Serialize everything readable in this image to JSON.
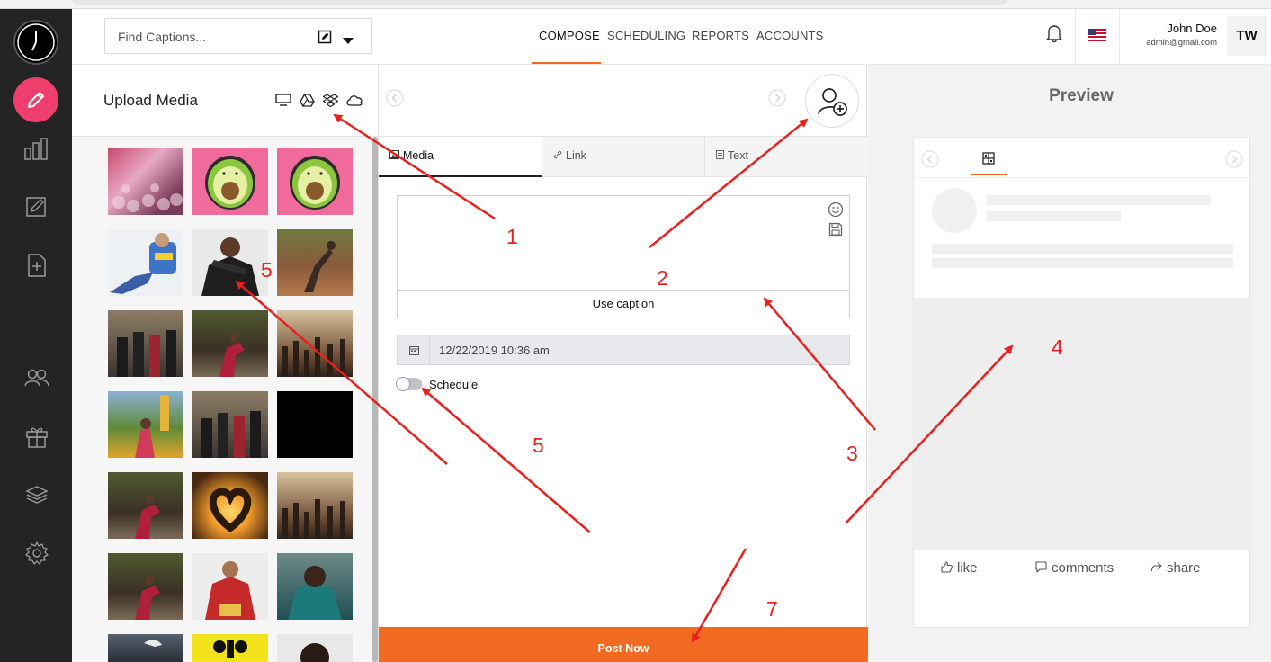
{
  "header": {
    "search_placeholder": "Find Captions...",
    "tabs": [
      {
        "label": "COMPOSE",
        "active": true
      },
      {
        "label": "SCHEDULING",
        "active": false
      },
      {
        "label": "REPORTS",
        "active": false
      },
      {
        "label": "ACCOUNTS",
        "active": false
      }
    ],
    "user_name": "John Doe",
    "user_email": "admin@gmail.com",
    "avatar_initials": "TW",
    "accent_color": "#f26a21"
  },
  "sidebar": {
    "icons": [
      "clock-logo-icon",
      "pencil-icon",
      "bar-chart-icon",
      "edit-note-icon",
      "add-page-icon",
      "users-icon",
      "gift-icon",
      "layers-icon",
      "gear-icon"
    ]
  },
  "upload": {
    "title": "Upload Media",
    "sources": [
      "desktop-icon",
      "google-drive-icon",
      "dropbox-icon",
      "cloud-icon"
    ]
  },
  "compose": {
    "tabs": [
      {
        "label": "Media",
        "icon": "image-icon",
        "active": true
      },
      {
        "label": "Link",
        "icon": "link-icon",
        "active": false
      },
      {
        "label": "Text",
        "icon": "text-doc-icon",
        "active": false
      }
    ],
    "caption_value": "",
    "use_caption_label": "Use caption",
    "date_value": "12/22/2019 10:36 am",
    "schedule_label": "Schedule",
    "schedule_on": false,
    "post_now_label": "Post Now"
  },
  "preview": {
    "title": "Preview",
    "actions": [
      {
        "label": "like",
        "icon": "thumbs-up-icon"
      },
      {
        "label": "comments",
        "icon": "comment-icon"
      },
      {
        "label": "share",
        "icon": "share-icon"
      }
    ]
  },
  "annotations": {
    "labels": [
      "1",
      "2",
      "3",
      "4",
      "5",
      "5",
      "7"
    ],
    "color": "#e8211d"
  }
}
